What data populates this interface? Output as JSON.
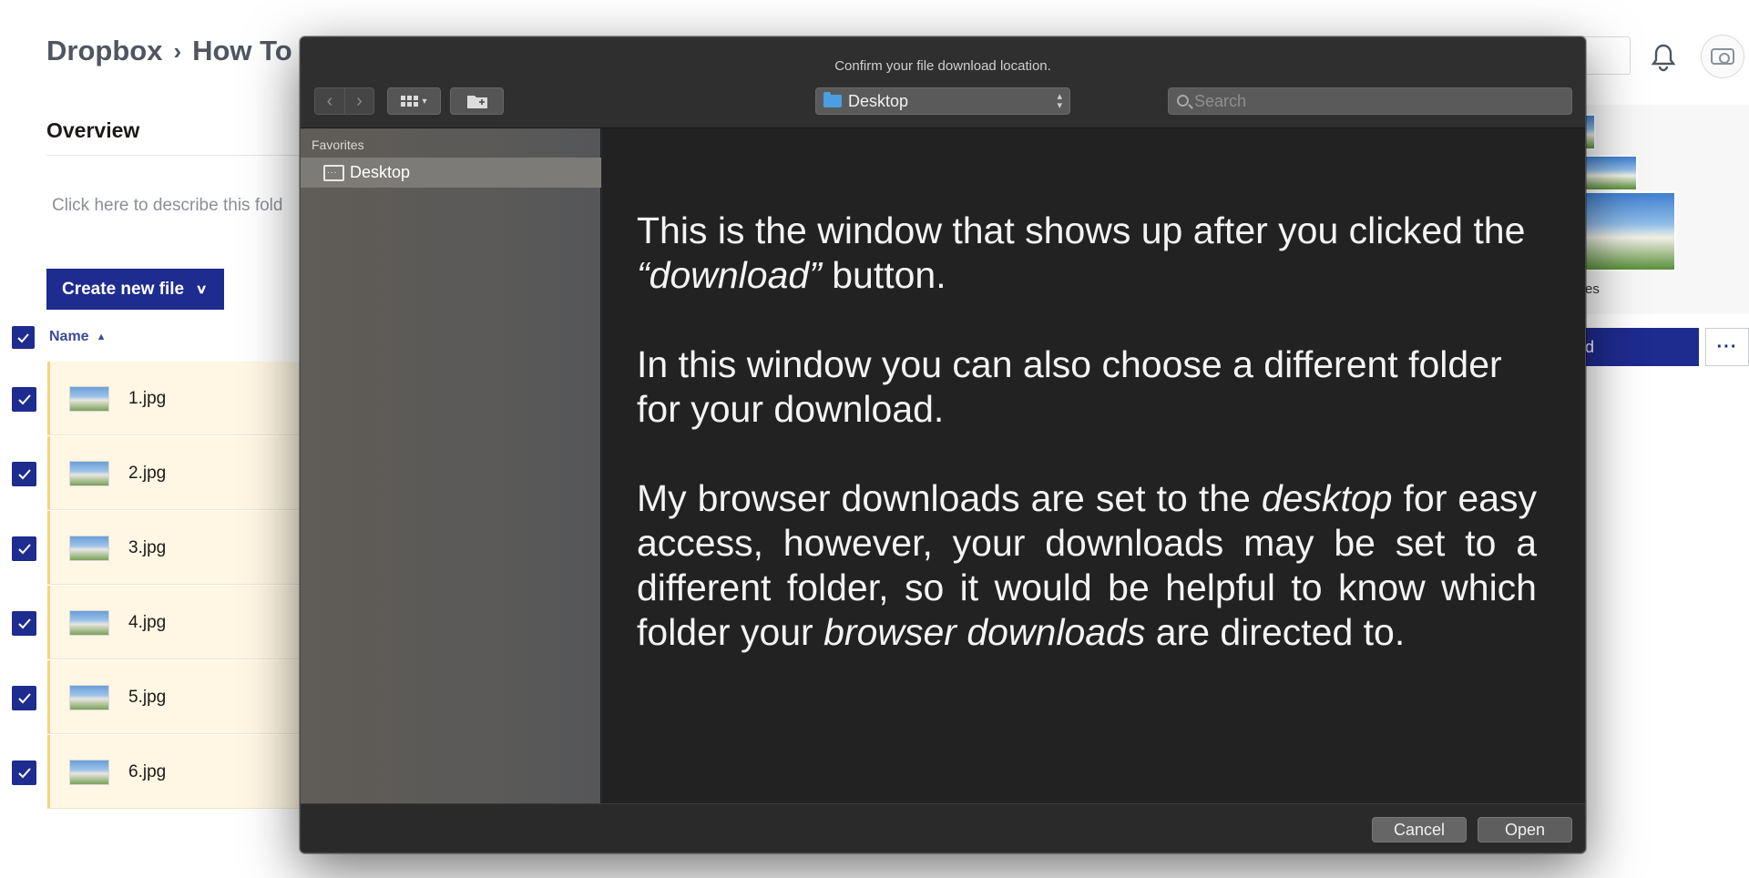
{
  "background_page": {
    "breadcrumb": [
      "Dropbox",
      "How To"
    ],
    "breadcrumb_separator": "›",
    "overview_label": "Overview",
    "description_placeholder": "Click here to describe this fold",
    "create_button_label": "Create new file",
    "name_column_label": "Name",
    "files": [
      {
        "name": "1.jpg",
        "checked": true
      },
      {
        "name": "2.jpg",
        "checked": true
      },
      {
        "name": "3.jpg",
        "checked": true
      },
      {
        "name": "4.jpg",
        "checked": true
      },
      {
        "name": "5.jpg",
        "checked": true
      },
      {
        "name": "6.jpg",
        "checked": true
      }
    ],
    "right_panel_label": "es",
    "right_button_label": "d",
    "more_label": "···"
  },
  "dialog": {
    "title": "Confirm your file download location.",
    "location": "Desktop",
    "search_placeholder": "Search",
    "sidebar": {
      "section_label": "Favorites",
      "items": [
        {
          "label": "Desktop",
          "selected": true
        }
      ]
    },
    "cancel_label": "Cancel",
    "open_label": "Open"
  },
  "annotation": {
    "p1_a": "This is the window that shows up after you clicked the ",
    "p1_em": "“download”",
    "p1_b": " button.",
    "p2": "In this window you can also choose a different folder for your download.",
    "p3_a": "My browser downloads are set to the ",
    "p3_em1": "desktop",
    "p3_b": " for easy access, however, your downloads may be set to a different folder, so it would be helpful to know which folder your ",
    "p3_em2": "browser downloads",
    "p3_c": " are directed to."
  },
  "colors": {
    "dropbox_blue": "#1e2b8f",
    "row_highlight": "#fff7e3",
    "dialog_bg": "#2c2c2c",
    "content_bg": "#222222",
    "folder_blue": "#4a9fe0"
  }
}
